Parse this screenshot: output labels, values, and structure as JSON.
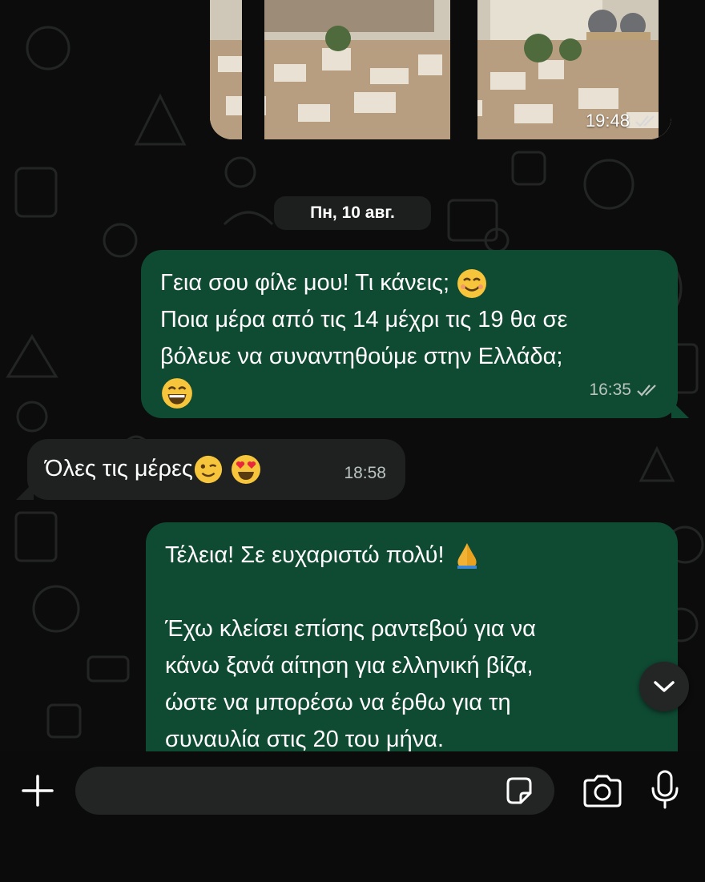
{
  "chat": {
    "image_message": {
      "time": "19:48",
      "status_icon": "double-check-icon"
    },
    "date_separator": "Пн, 10 авг.",
    "messages": [
      {
        "direction": "outgoing",
        "lines": [
          "Γεια σου φίλε μου! Τι κάνεις;",
          "Ποια μέρα από τις 14 μέχρι τις 19 θα σε",
          "βόλευε να συναντηθούμε στην Ελλάδα;"
        ],
        "emojis": [
          "smiling-face-emoji",
          "grinning-face-emoji"
        ],
        "time": "16:35",
        "status_icon": "double-check-icon"
      },
      {
        "direction": "incoming",
        "lines": [
          "Όλες τις μέρες"
        ],
        "emojis": [
          "winking-face-emoji",
          "heart-eyes-emoji"
        ],
        "time": "18:58"
      },
      {
        "direction": "outgoing",
        "lines": [
          "Τέλεια! Σε ευχαριστώ πολύ!",
          "",
          "Έχω κλείσει επίσης ραντεβού για να",
          "κάνω ξανά αίτηση για ελληνική βίζα,",
          "ώστε να μπορέσω να έρθω για τη",
          "συναυλία στις 20 του μήνα."
        ],
        "emojis": [
          "folded-hands-emoji"
        ]
      }
    ]
  },
  "composer": {
    "input_value": "",
    "icons": [
      "plus-icon",
      "sticker-icon",
      "camera-icon",
      "microphone-icon"
    ]
  },
  "scroll_button_icon": "chevron-down-icon",
  "colors": {
    "outgoing_bubble": "#0f4a33",
    "incoming_bubble": "#1f2121",
    "background": "#0c0c0c",
    "meta_text": "#b9c4bf"
  }
}
